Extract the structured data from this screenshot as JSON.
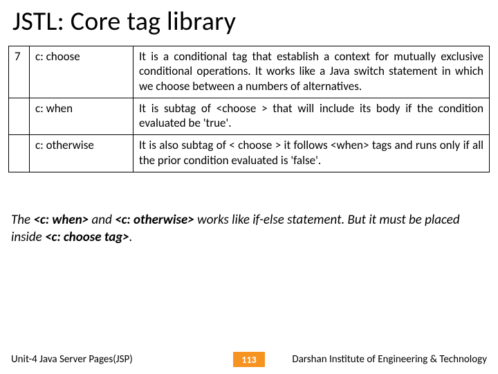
{
  "title": "JSTL: Core tag library",
  "table": {
    "rows": [
      {
        "num": "7",
        "tag": "c: choose",
        "desc": "It is a conditional tag that establish a context for mutually exclusive conditional operations. It works like a Java switch statement in which we choose between a numbers of alternatives."
      },
      {
        "num": "",
        "tag": "c: when",
        "desc": "It is subtag of <choose > that will include its body if the condition evaluated be 'true'."
      },
      {
        "num": "",
        "tag": "c: otherwise",
        "desc": "It is also subtag of < choose > it follows <when> tags and runs only if all the prior condition evaluated is 'false'."
      }
    ]
  },
  "caption": {
    "pre": "The ",
    "b1": "<c: when>",
    "mid1": " and ",
    "b2": "<c: otherwise>",
    "mid2": " works like if-else statement. But it must be placed inside ",
    "b3": "<c: choose tag>",
    "post": "."
  },
  "footer": {
    "left": "Unit-4 Java Server Pages(JSP)",
    "page": "113",
    "right": "Darshan Institute of Engineering & Technology"
  }
}
